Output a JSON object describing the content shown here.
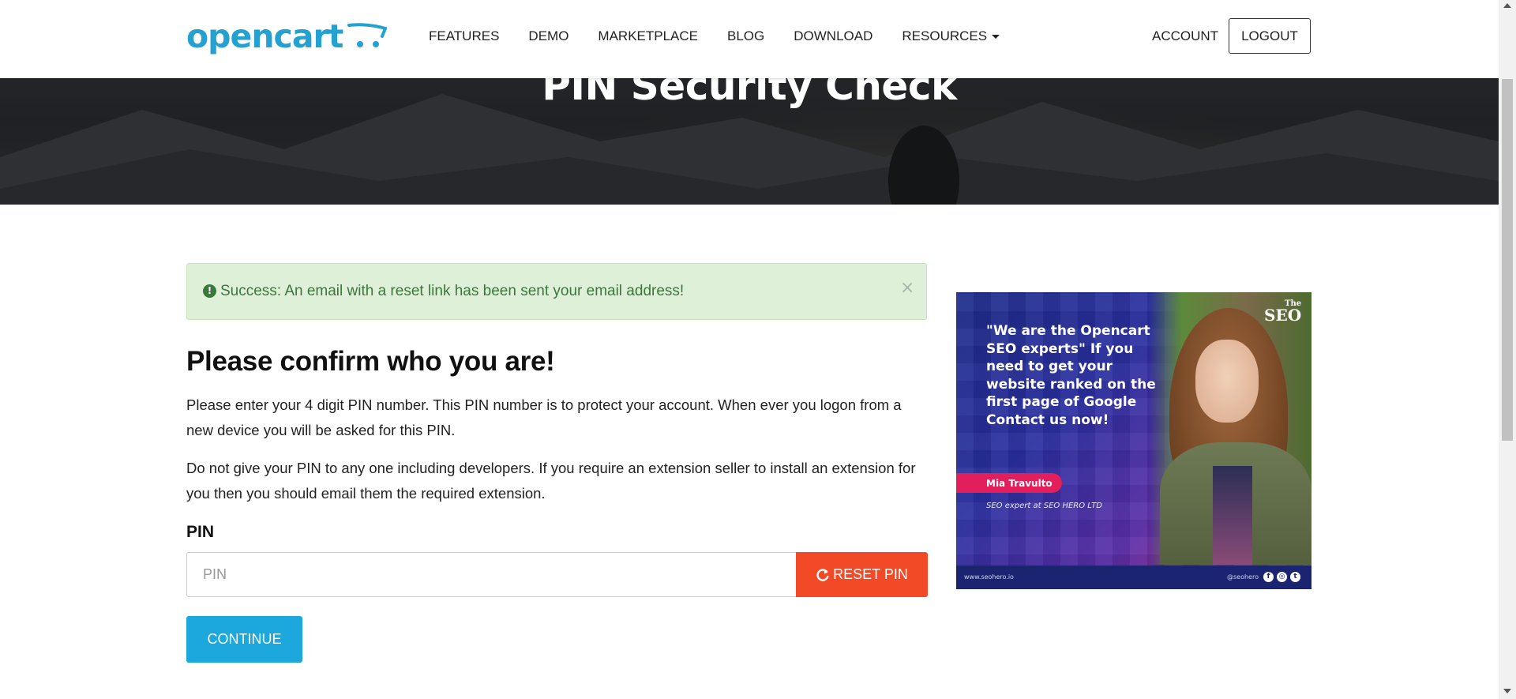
{
  "header": {
    "logo_text": "opencart",
    "nav": [
      "FEATURES",
      "DEMO",
      "MARKETPLACE",
      "BLOG",
      "DOWNLOAD",
      "RESOURCES"
    ],
    "account_label": "ACCOUNT",
    "logout_label": "LOGOUT"
  },
  "hero": {
    "title": "PIN Security Check"
  },
  "alert": {
    "icon": "exclamation-circle-icon",
    "message": "Success: An email with a reset link has been sent your email address!",
    "close": "×"
  },
  "content": {
    "heading": "Please confirm who you are!",
    "para1": "Please enter your 4 digit PIN number. This PIN number is to protect your account. When ever you logon from a new device you will be asked for this PIN.",
    "para2": "Do not give your PIN to any one including developers. If you require an extension seller to install an extension for you then you should email them the required extension.",
    "pin_label": "PIN",
    "pin_placeholder": "PIN",
    "pin_value": "",
    "reset_label": "RESET PIN",
    "continue_label": "CONTINUE"
  },
  "ad": {
    "brand_small": "The",
    "brand": "SEO",
    "headline": "\"We are the Opencart SEO experts\" If you need to get your website ranked on the first page of Google Contact us now!",
    "name": "Mia Travulto",
    "role": "SEO expert at SEO HERO LTD",
    "url": "www.seohero.io",
    "handle": "@seohero"
  },
  "colors": {
    "brand_blue": "#23a1d1",
    "continue_blue": "#1ca8dd",
    "reset_orange": "#f24a26",
    "alert_green_bg": "#dff0d8",
    "alert_green_text": "#3c763d"
  }
}
